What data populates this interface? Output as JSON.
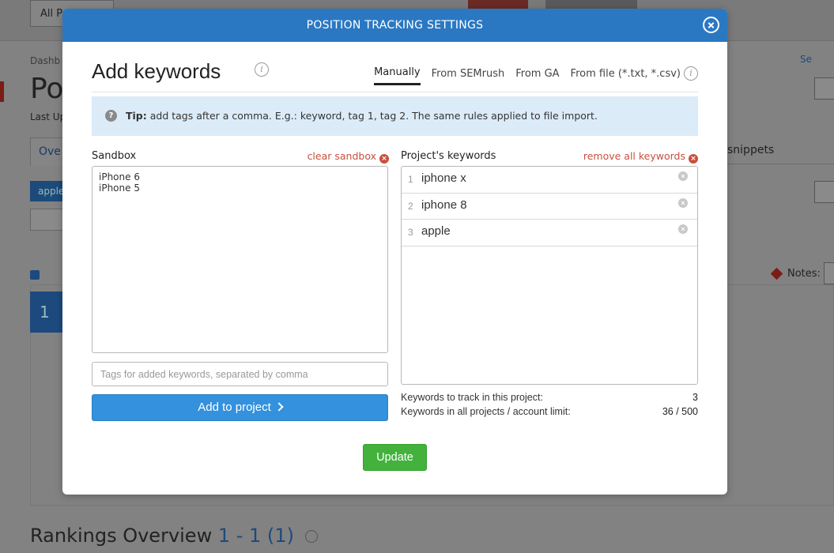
{
  "background": {
    "all_projects_label": "All P",
    "breadcrumb": "Dashb",
    "page_title": "Po",
    "last_updated": "Last Up",
    "tab_overview": "Ove",
    "tab_snippets": "snippets",
    "filter_tag": "apple",
    "header_link": "Se",
    "notes_label": "Notes:",
    "rankings_title": "Rankings Overview",
    "rankings_count": "1 - 1 (1)",
    "widget_value": "1"
  },
  "modal": {
    "header_title": "POSITION TRACKING SETTINGS",
    "title": "Add keywords",
    "tabs": [
      {
        "label": "Manually",
        "active": true
      },
      {
        "label": "From SEMrush",
        "active": false
      },
      {
        "label": "From GA",
        "active": false
      },
      {
        "label": "From file (*.txt, *.csv)",
        "active": false
      }
    ],
    "tip": {
      "label": "Tip:",
      "text": " add tags after a comma. E.g.: keyword, tag 1, tag 2. The same rules applied to file import."
    },
    "sandbox": {
      "label": "Sandbox",
      "clear_label": "clear sandbox",
      "content": "iPhone 6\niPhone 5",
      "tags_placeholder": "Tags for added keywords, separated by comma",
      "add_button": "Add to project"
    },
    "project_keywords": {
      "label": "Project's keywords",
      "remove_all_label": "remove all keywords",
      "items": [
        {
          "num": "1",
          "keyword": "iphone x"
        },
        {
          "num": "2",
          "keyword": "iphone 8"
        },
        {
          "num": "3",
          "keyword": "apple"
        }
      ]
    },
    "stats": {
      "track_label": "Keywords to track in this project:",
      "track_value": "3",
      "limit_label": "Keywords in all projects / account limit:",
      "limit_value": "36 / 500"
    },
    "update_button": "Update"
  },
  "colors": {
    "header_blue": "#2b78c2",
    "button_blue": "#3391dd",
    "update_green": "#42b23d",
    "link_red": "#c7503f",
    "tip_bg": "#dcebf8"
  }
}
